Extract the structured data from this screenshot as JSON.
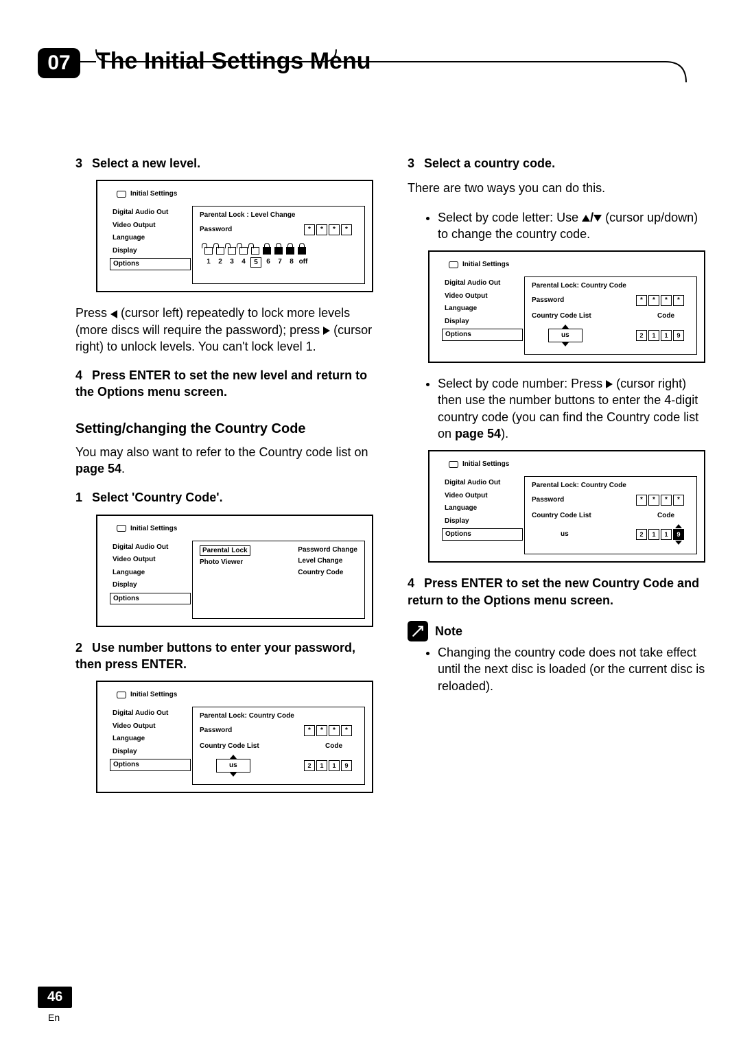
{
  "chapter": {
    "number": "07",
    "title": "The Initial Settings Menu"
  },
  "left": {
    "step3": {
      "num": "3",
      "title": "Select a new level."
    },
    "para1a": "Press ",
    "para1b": " (cursor left) repeatedly to lock more levels (more discs will require the password); press ",
    "para1c": " (cursor right) to unlock levels. You can't lock level 1.",
    "step4": {
      "num": "4",
      "title": "Press ENTER to set the new level and return to the Options menu screen."
    },
    "subheading": "Setting/changing the Country Code",
    "para2a": "You may also want to refer to the Country code list on ",
    "para2b": "page 54",
    "para2c": ".",
    "step1": {
      "num": "1",
      "title": "Select 'Country Code'."
    },
    "step2": {
      "num": "2",
      "title": "Use number buttons to enter your password, then press ENTER."
    }
  },
  "right": {
    "step3": {
      "num": "3",
      "title": "Select a country code."
    },
    "intro": "There are two ways you can do this.",
    "bullet1a": "Select by code letter: Use ",
    "bullet1b": " (cursor up/down) to change the country code.",
    "bullet2a": "Select by code number: Press ",
    "bullet2b": " (cursor right) then use the number buttons to enter the 4-digit country code (you can find the Country code list on ",
    "bullet2c": "page 54",
    "bullet2d": ").",
    "step4": {
      "num": "4",
      "title": "Press ENTER to set the new Country Code and return to the Options menu screen."
    },
    "noteLabel": "Note",
    "noteText": "Changing the country code does not take effect until the next disc is loaded (or the current disc is reloaded)."
  },
  "ui": {
    "title": "Initial Settings",
    "menu": [
      "Digital Audio Out",
      "Video Output",
      "Language",
      "Display",
      "Options"
    ],
    "levelChange": {
      "heading": "Parental Lock : Level Change",
      "password": "Password",
      "nums": [
        "1",
        "2",
        "3",
        "4",
        "5",
        "6",
        "7",
        "8",
        "off"
      ],
      "selected": "5"
    },
    "countryCodeMenu": {
      "col1Sel": "Parental Lock",
      "col1Other": "Photo Viewer",
      "col2": [
        "Password Change",
        "Level Change",
        "Country Code"
      ]
    },
    "cc": {
      "heading": "Parental Lock: Country Code",
      "password": "Password",
      "listLabel": "Country Code List",
      "codeLabel": "Code",
      "listValue": "us",
      "code": [
        "2",
        "1",
        "1",
        "9"
      ]
    }
  },
  "footer": {
    "page": "46",
    "lang": "En"
  }
}
